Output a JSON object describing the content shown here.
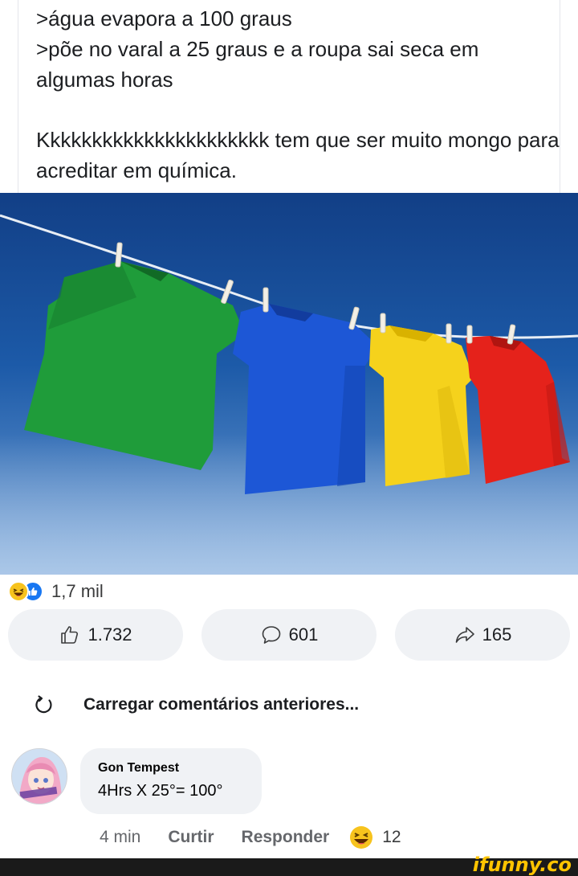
{
  "post": {
    "lines": [
      ">água evapora a 100 graus",
      ">põe no varal a 25 graus e a roupa sai seca em algumas horas",
      "Kkkkkkkkkkkkkkkkkkkkkk tem que ser muito mongo para acreditar em química."
    ]
  },
  "photo": {
    "subject": "four t-shirts on a clothesline",
    "shirt_colors": [
      "#1f9c3a",
      "#1d57d6",
      "#f5d21c",
      "#e5221b"
    ],
    "sky_color": "#1c5aa8"
  },
  "reactions": {
    "icons": [
      "laugh-emoji-icon",
      "like-icon"
    ],
    "total": "1,7 mil"
  },
  "actions": {
    "like_count": "1.732",
    "comment_count": "601",
    "share_count": "165"
  },
  "comments": {
    "load_previous": "Carregar comentários anteriores...",
    "items": [
      {
        "author": "Gon Tempest",
        "text": "4Hrs X 25°= 100°",
        "time": "4 min",
        "like_label": "Curtir",
        "reply_label": "Responder",
        "reaction_count": "12"
      }
    ]
  },
  "watermark": "ifunny.co",
  "colors": {
    "accent": "#1877f2",
    "button_bg": "#f0f2f5",
    "muted_text": "#65676b",
    "watermark": "#ffc400"
  }
}
